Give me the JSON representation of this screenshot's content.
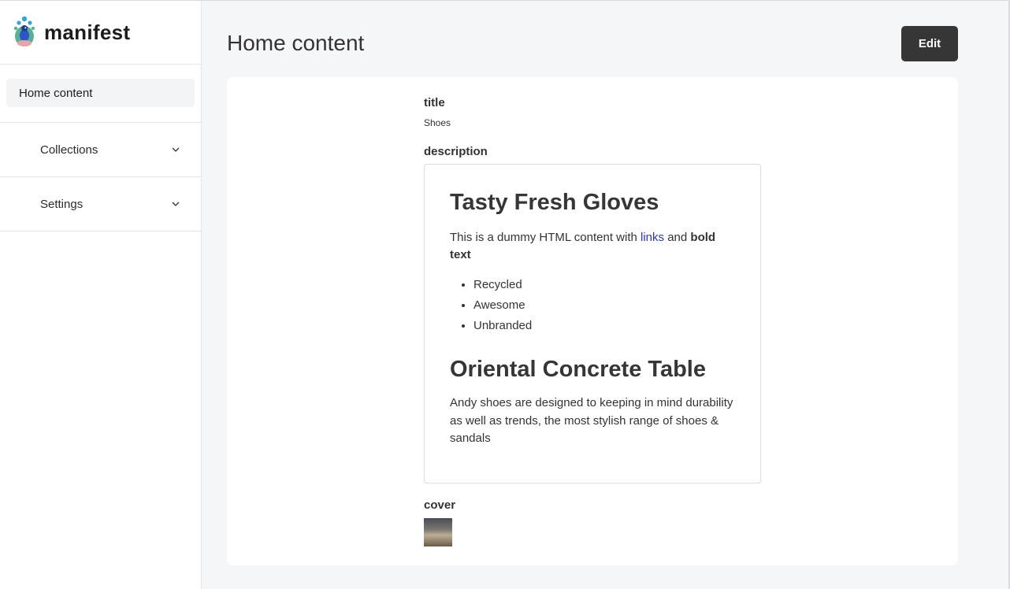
{
  "brand": {
    "name": "manifest",
    "logo_icon": "peacock-logo-icon"
  },
  "sidebar": {
    "active_item": "Home content",
    "groups": [
      {
        "label": "Collections",
        "icon": "chevron-down-icon"
      },
      {
        "label": "Settings",
        "icon": "chevron-down-icon"
      }
    ]
  },
  "main": {
    "title": "Home content",
    "edit_label": "Edit",
    "fields": {
      "title_label": "title",
      "title_value": "Shoes",
      "description_label": "description",
      "cover_label": "cover"
    },
    "description": {
      "heading1": "Tasty Fresh Gloves",
      "p1_prefix": "This is a dummy HTML content with ",
      "p1_link": "links",
      "p1_middle": " and ",
      "p1_bold": "bold text",
      "list": [
        "Recycled",
        "Awesome",
        "Unbranded"
      ],
      "heading2": "Oriental Concrete Table",
      "p2": "Andy shoes are designed to keeping in mind durability as well as trends, the most stylish range of shoes & sandals"
    }
  },
  "colors": {
    "button_bg": "#363636",
    "link": "#2b3bbd",
    "page_bg": "#f5f6f8"
  }
}
